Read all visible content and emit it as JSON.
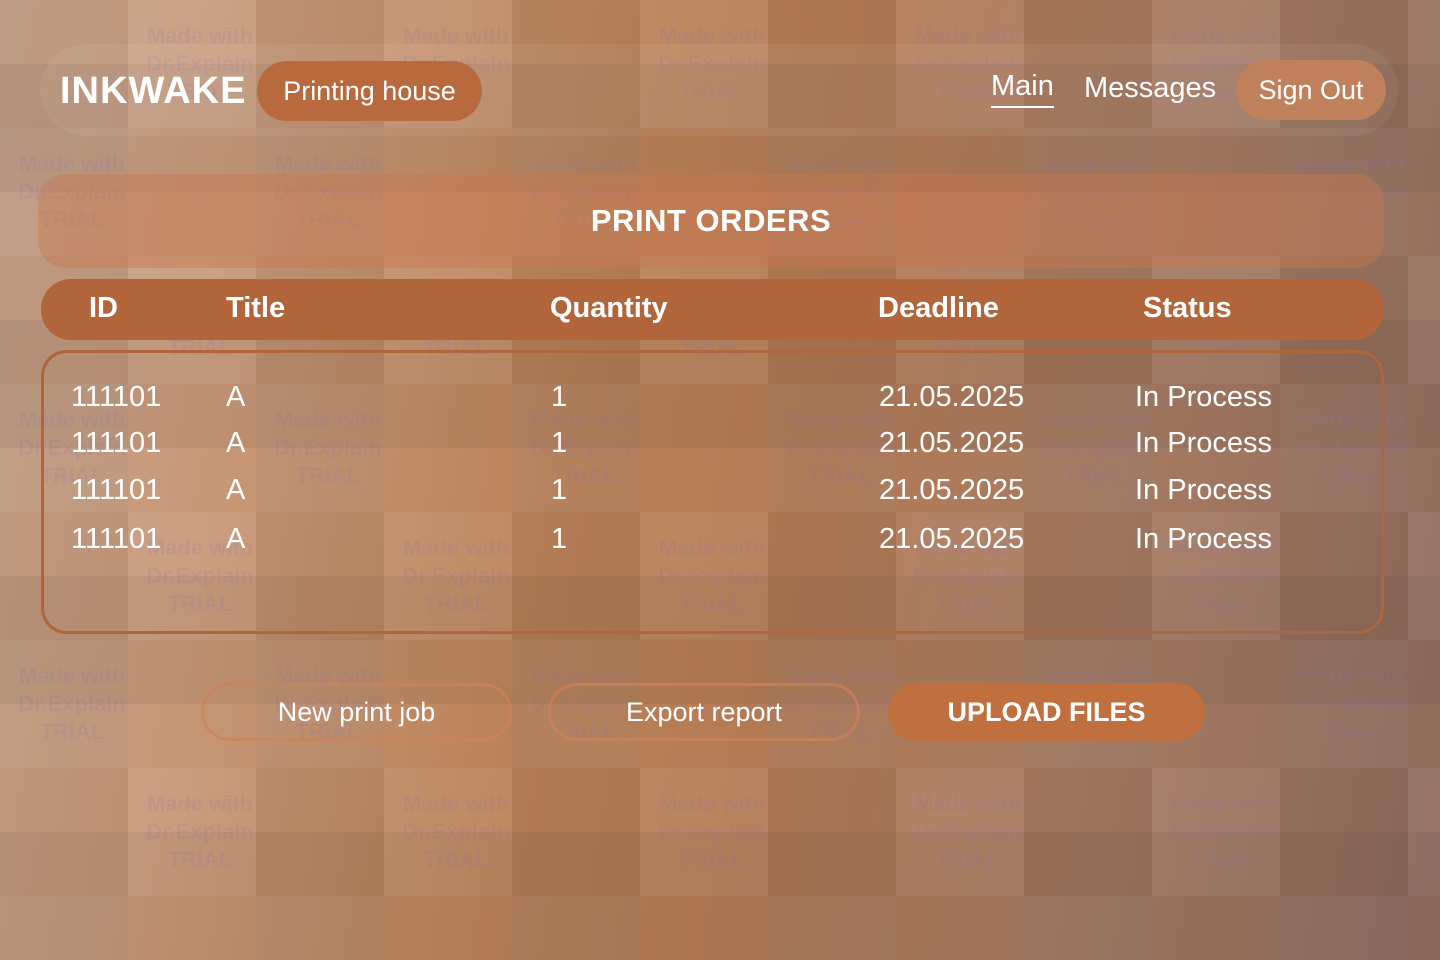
{
  "header": {
    "logo": "INKWAKE",
    "tag": "Printing house",
    "nav": {
      "main": "Main",
      "messages": "Messages"
    },
    "sign_out": "Sign Out"
  },
  "page_title": "PRINT ORDERS",
  "table": {
    "columns": [
      "ID",
      "Title",
      "Quantity",
      "Deadline",
      "Status"
    ],
    "rows": [
      {
        "id": "111101",
        "title": "A",
        "quantity": "1",
        "deadline": "21.05.2025",
        "status": "In Process"
      },
      {
        "id": "111101",
        "title": "A",
        "quantity": "1",
        "deadline": "21.05.2025",
        "status": "In Process"
      },
      {
        "id": "111101",
        "title": "A",
        "quantity": "1",
        "deadline": "21.05.2025",
        "status": "In Process"
      },
      {
        "id": "111101",
        "title": "A",
        "quantity": "1",
        "deadline": "21.05.2025",
        "status": "In Process"
      }
    ]
  },
  "actions": {
    "new_print_job": "New print job",
    "export_report": "Export report",
    "upload_files": "UPLOAD FILES"
  },
  "watermark": [
    "Made with",
    "Dr.Explain",
    "TRIAL"
  ],
  "colors": {
    "accent": "#b86a3e",
    "table_header": "#b2643a",
    "sign_out": "#c0805c",
    "upload": "#c0703e"
  }
}
